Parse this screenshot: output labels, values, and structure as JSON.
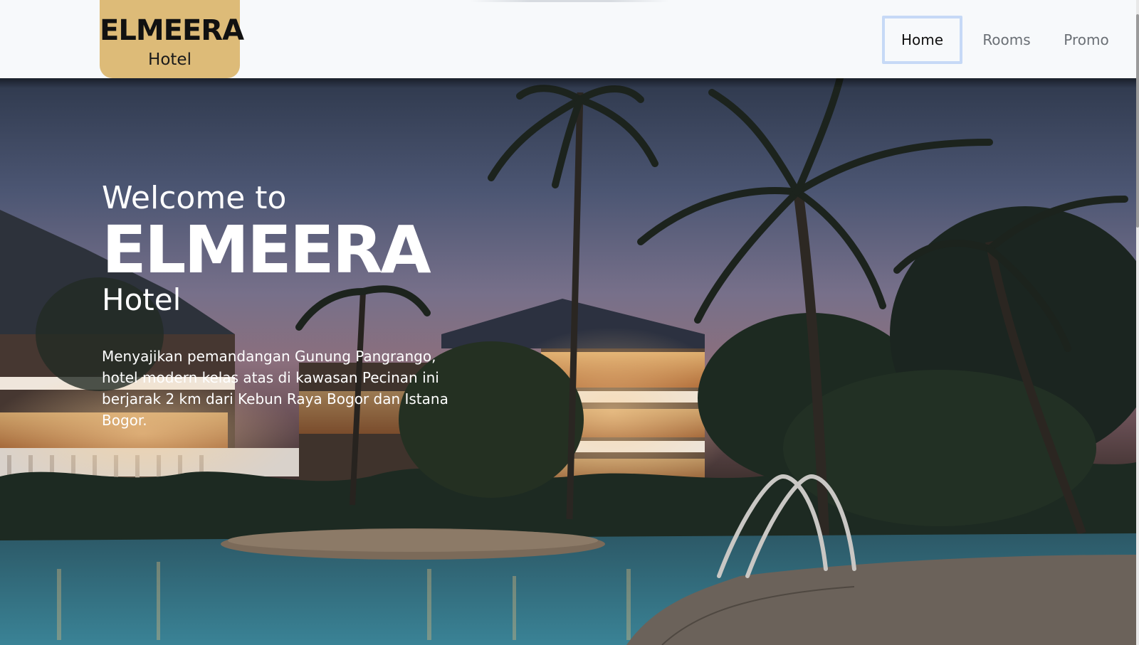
{
  "brand": {
    "name": "ELMEERA",
    "subtitle": "Hotel",
    "color": "#ddbb78"
  },
  "nav": {
    "items": [
      {
        "label": "Home",
        "active": true
      },
      {
        "label": "Rooms",
        "active": false
      },
      {
        "label": "Promo",
        "active": false
      }
    ],
    "active_border_color": "#c6d9f6"
  },
  "hero": {
    "welcome": "Welcome to",
    "title": "ELMEERA",
    "subtitle": "Hotel",
    "description": "Menyajikan pemandangan Gunung Pangrango, hotel modern kelas atas di kawasan Pecinan ini berjarak 2 km dari Kebun Raya Bogor dan Istana Bogor.",
    "background": "hotel-pool-palm-trees-dusk-photo"
  }
}
